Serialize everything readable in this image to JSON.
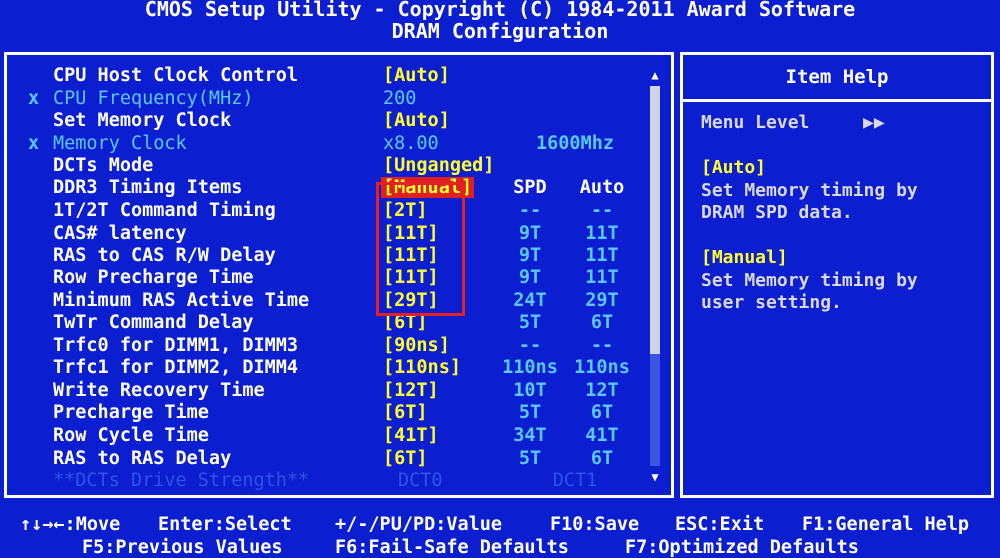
{
  "header": {
    "title": "CMOS Setup Utility - Copyright (C) 1984-2011 Award Software",
    "subtitle": "DRAM Configuration"
  },
  "rows": [
    {
      "mark": "",
      "label": "CPU Host Clock Control",
      "value": "[Auto]",
      "spd": "",
      "auto": ""
    },
    {
      "mark": "x",
      "label": "CPU Frequency(MHz)",
      "value": " 200",
      "spd": "",
      "auto": ""
    },
    {
      "mark": "",
      "label": "Set Memory Clock",
      "value": "[Auto]",
      "spd": "",
      "auto": ""
    },
    {
      "mark": "x",
      "label": "Memory Clock",
      "value": " x8.00",
      "spd": "",
      "auto": "1600Mhz"
    },
    {
      "mark": "",
      "label": "DCTs Mode",
      "value": "[Unganged]",
      "spd": "",
      "auto": ""
    },
    {
      "mark": "",
      "label": "DDR3 Timing Items",
      "value": "[Manual]",
      "spd": "SPD",
      "auto": "Auto"
    },
    {
      "mark": "",
      "label": "1T/2T Command Timing",
      "value": "[2T]",
      "spd": "--",
      "auto": "--"
    },
    {
      "mark": "",
      "label": "CAS# latency",
      "value": "[11T]",
      "spd": "9T",
      "auto": "11T"
    },
    {
      "mark": "",
      "label": "RAS to CAS R/W Delay",
      "value": "[11T]",
      "spd": "9T",
      "auto": "11T"
    },
    {
      "mark": "",
      "label": "Row Precharge Time",
      "value": "[11T]",
      "spd": "9T",
      "auto": "11T"
    },
    {
      "mark": "",
      "label": "Minimum RAS Active Time",
      "value": "[29T]",
      "spd": "24T",
      "auto": "29T"
    },
    {
      "mark": "",
      "label": "TwTr Command Delay",
      "value": "[6T]",
      "spd": "5T",
      "auto": "6T"
    },
    {
      "mark": "",
      "label": "Trfc0 for DIMM1, DIMM3",
      "value": "[90ns]",
      "spd": "--",
      "auto": "--"
    },
    {
      "mark": "",
      "label": "Trfc1 for DIMM2, DIMM4",
      "value": "[110ns]",
      "spd": "110ns",
      "auto": "110ns"
    },
    {
      "mark": "",
      "label": "Write Recovery Time",
      "value": "[12T]",
      "spd": "10T",
      "auto": "12T"
    },
    {
      "mark": "",
      "label": "Precharge Time",
      "value": "[6T]",
      "spd": "5T",
      "auto": "6T"
    },
    {
      "mark": "",
      "label": "Row Cycle Time",
      "value": "[41T]",
      "spd": "34T",
      "auto": "41T"
    },
    {
      "mark": "",
      "label": "RAS to RAS Delay",
      "value": "[6T]",
      "spd": "5T",
      "auto": "6T"
    },
    {
      "mark": "",
      "label": "**DCTs Drive Strength**",
      "value": "DCT0",
      "spd": "",
      "auto": "DCT1"
    }
  ],
  "help": {
    "title": "Item Help",
    "menu_level": "Menu Level",
    "menu_level_arrows": "▶▶",
    "opt1_name": "[Auto]",
    "opt1_line1": "Set Memory timing by",
    "opt1_line2": "DRAM SPD data.",
    "opt2_name": "[Manual]",
    "opt2_line1": "Set Memory timing by",
    "opt2_line2": "user setting."
  },
  "footer": {
    "move": "↑↓→←:Move",
    "enter": "Enter:Select",
    "value": "+/-/PU/PD:Value",
    "save": "F10:Save",
    "exit": "ESC:Exit",
    "general_help": "F1:General Help",
    "previous": "F5:Previous Values",
    "failsafe": "F6:Fail-Safe Defaults",
    "optimized": "F7:Optimized Defaults"
  },
  "colors": {
    "background": "#0b1fd0",
    "value_yellow": "#ffff30",
    "disabled_cyan": "#58c8ff",
    "highlight_red": "#e02020"
  }
}
